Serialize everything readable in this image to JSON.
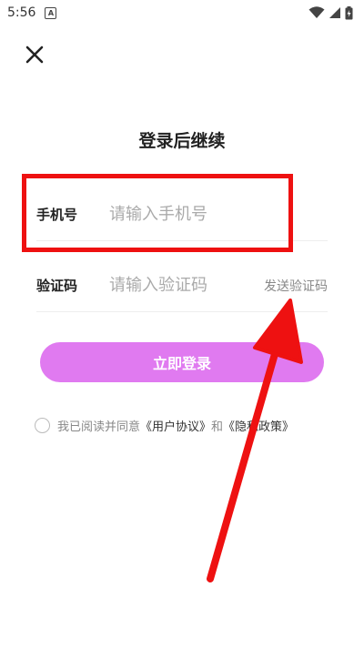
{
  "status_bar": {
    "time": "5:56",
    "notification_icon": "A"
  },
  "header": {
    "close_icon": "close-icon",
    "title": "登录后继续"
  },
  "form": {
    "phone": {
      "label": "手机号",
      "placeholder": "请输入手机号"
    },
    "code": {
      "label": "验证码",
      "placeholder": "请输入验证码",
      "send_button": "发送验证码"
    },
    "login_button": "立即登录",
    "login_button_color": "#e07af0"
  },
  "agreement": {
    "prefix": "我已阅读并同意",
    "user_agreement": "《用户协议》",
    "conjunction": "和",
    "privacy_policy": "《隐私政策》"
  },
  "annotation_color": "#ee1111"
}
